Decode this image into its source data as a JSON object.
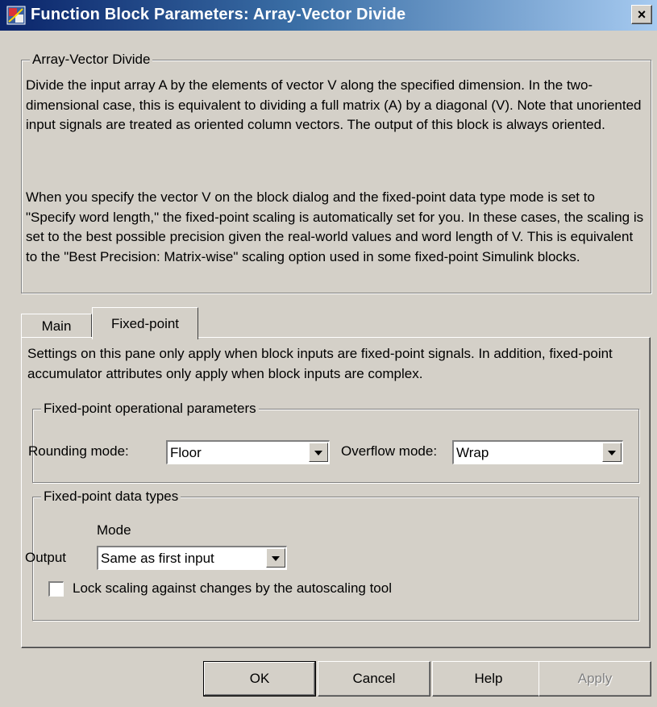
{
  "window": {
    "title": "Function Block Parameters: Array-Vector Divide",
    "close_label": "×",
    "icon": "simulink-block-icon"
  },
  "block_group": {
    "legend": "Array-Vector Divide",
    "paragraph1": "Divide the input array A by the elements of vector V along the specified dimension.  In the two-dimensional case, this is equivalent to dividing a full matrix (A) by a diagonal (V). Note that unoriented input signals are treated as oriented column vectors. The output of this block is always oriented.",
    "paragraph2": "When you specify the vector V on the block dialog and the fixed-point data type mode is set to \"Specify word length,\" the fixed-point scaling is automatically set for you. In these cases, the scaling is set to the best possible precision given the real-world values and word length of V. This is equivalent to the \"Best Precision: Matrix-wise\" scaling option used in some fixed-point Simulink blocks."
  },
  "tabs": [
    {
      "label": "Main",
      "active": false
    },
    {
      "label": "Fixed-point",
      "active": true
    }
  ],
  "fixed_point": {
    "intro": "Settings on this pane only apply when block inputs are fixed-point signals. In addition, fixed-point accumulator attributes only apply when block inputs are complex.",
    "operational": {
      "legend": "Fixed-point operational parameters",
      "rounding_label": "Rounding mode:",
      "rounding_value": "Floor",
      "overflow_label": "Overflow mode:",
      "overflow_value": "Wrap"
    },
    "data_types": {
      "legend": "Fixed-point data types",
      "mode_header": "Mode",
      "output_label": "Output",
      "output_value": "Same as first input",
      "lock_scaling_label": "Lock scaling against changes by the autoscaling tool",
      "lock_scaling_checked": false
    }
  },
  "buttons": {
    "ok": "OK",
    "cancel": "Cancel",
    "help": "Help",
    "apply": "Apply"
  },
  "colors": {
    "title_start": "#0a246a",
    "title_end": "#a6caf0",
    "face": "#d4d0c8"
  }
}
